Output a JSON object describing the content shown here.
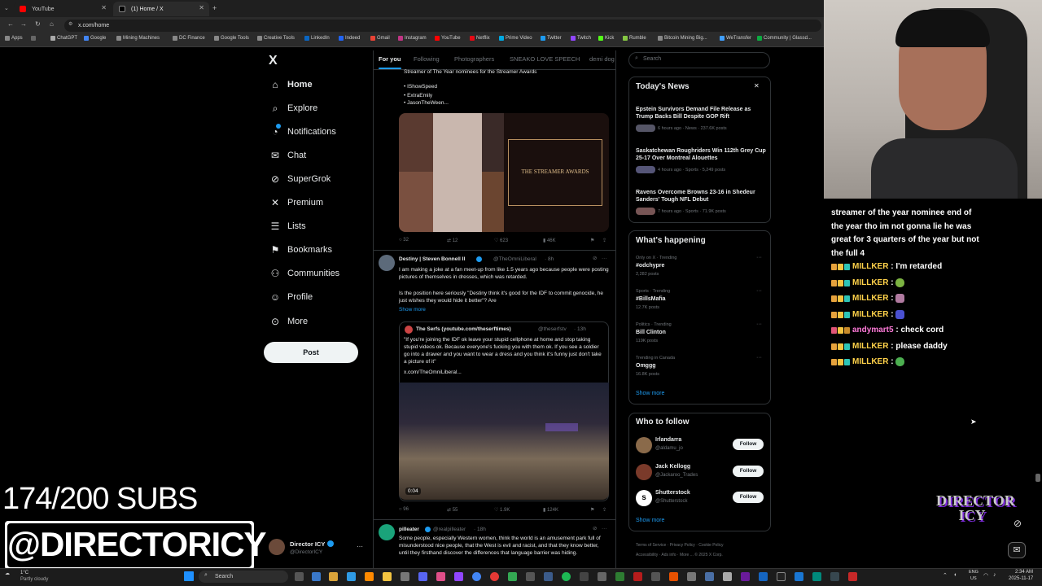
{
  "browser": {
    "tabs": [
      {
        "title": "YouTube"
      },
      {
        "title": "(1) Home / X"
      }
    ],
    "url": "x.com/home",
    "bookmarks": [
      "Apps",
      "ChatGPT",
      "Google",
      "Mining Machines",
      "DC Finance",
      "Google Tools",
      "Creative Tools",
      "LinkedIn",
      "Indeed",
      "Gmail",
      "Instagram",
      "YouTube",
      "Netflix",
      "Prime Video",
      "Twitter",
      "Twitch",
      "Kick",
      "Rumble",
      "Bitcoin Mining Big...",
      "WeTransfer",
      "Community | Glassd..."
    ]
  },
  "x": {
    "logo": "X",
    "nav": [
      {
        "label": "Home",
        "icon": "home-icon"
      },
      {
        "label": "Explore",
        "icon": "search-icon"
      },
      {
        "label": "Notifications",
        "icon": "bell-icon"
      },
      {
        "label": "Chat",
        "icon": "mail-icon"
      },
      {
        "label": "SuperGrok",
        "icon": "grok-icon"
      },
      {
        "label": "Premium",
        "icon": "x-icon"
      },
      {
        "label": "Lists",
        "icon": "list-icon"
      },
      {
        "label": "Bookmarks",
        "icon": "bookmark-icon"
      },
      {
        "label": "Communities",
        "icon": "people-icon"
      },
      {
        "label": "Profile",
        "icon": "person-icon"
      },
      {
        "label": "More",
        "icon": "more-circle-icon"
      }
    ],
    "post_label": "Post",
    "account": {
      "name": "Director ICY",
      "handle": "@DirectorICY"
    },
    "feed_tabs": [
      "For you",
      "Following",
      "Photographers",
      "SNEAKO LOVE SPEECH",
      "demi dog"
    ],
    "search_placeholder": "Search",
    "tweet1": {
      "top_line": "Streamer of The Year nominees for the Streamer Awards",
      "bullets": [
        "• IShowSpeed",
        "• ExtraEmily",
        "• JasonTheWeen..."
      ],
      "image_text": "THE STREAMER AWARDS",
      "stats": {
        "replies": "32",
        "reposts": "12",
        "likes": "623",
        "views": "46K"
      }
    },
    "tweet2": {
      "name": "Destiny | Steven Bonnell II",
      "handle": "@TheOmniLiberal",
      "time": "· 8h",
      "text1": "I am making a joke at a fan meet-up from like 1.5 years ago because people were posting pictures of themselves in dresses, which was retarded.",
      "text2": "Is the position here seriously \"Destiny think it's good for the IDF to commit genocide, he just wishes they would hide it better\"? Are",
      "show_more": "Show more",
      "quote": {
        "name": "The Serfs (youtube.com/theserftimes)",
        "handle": "@theserfstv",
        "time": "· 13h",
        "text": "\"If you're joining the IDF ok leave your stupid cellphone at home and stop taking stupid videos ok. Because everyone's fucking you with them ok. If you see a soldier go into a drawer and you want to wear a dress and you think it's funny just don't take a picture of it\"",
        "link": "x.com/TheOmniLiberal...",
        "video_time": "0:04"
      },
      "stats": {
        "replies": "96",
        "reposts": "55",
        "likes": "1.9K",
        "views": "124K"
      }
    },
    "tweet3": {
      "name": "pilleater",
      "handle": "@realpilleater",
      "time": "· 18h",
      "text": "Some people, especially Western women, think the world is an amusement park full of misunderstood nice people, that the West is evil and racist, and that they know better, until they firsthand discover the differences that language barrier was hiding."
    },
    "news": {
      "title": "Today's News",
      "items": [
        {
          "headline": "Epstein Survivors Demand File Release as Trump Backs Bill Despite GOP Rift",
          "meta": "6 hours ago · News · 237.6K posts"
        },
        {
          "headline": "Saskatchewan Roughriders Win 112th Grey Cup 25-17 Over Montreal Alouettes",
          "meta": "4 hours ago · Sports · 5,249 posts"
        },
        {
          "headline": "Ravens Overcome Browns 23-16 in Shedeur Sanders' Tough NFL Debut",
          "meta": "7 hours ago · Sports · 71.9K posts"
        }
      ]
    },
    "happening": {
      "title": "What's happening",
      "items": [
        {
          "context": "Only on X · Trending",
          "name": "#odchypre",
          "posts": "2,282 posts"
        },
        {
          "context": "Sports · Trending",
          "name": "#BillsMafia",
          "posts": "12.7K posts"
        },
        {
          "context": "Politics · Trending",
          "name": "Bill Clinton",
          "posts": "119K posts"
        },
        {
          "context": "Trending in Canada",
          "name": "Omggg",
          "posts": "16.8K posts"
        }
      ],
      "show_more": "Show more"
    },
    "who_to_follow": {
      "title": "Who to follow",
      "items": [
        {
          "name": "Irlandarra",
          "handle": "@aldamu_jo"
        },
        {
          "name": "Jack Kellogg",
          "handle": "@Jackaroo_Trades"
        },
        {
          "name": "Shutterstock",
          "handle": "@Shutterstock"
        }
      ],
      "follow_label": "Follow",
      "show_more": "Show more"
    },
    "footer": [
      "Terms of Service",
      "Privacy Policy",
      "Cookie Policy",
      "Accessibility",
      "Ads info",
      "More ...",
      "© 2025 X Corp."
    ]
  },
  "chat": {
    "first": "streamer of the year nominee end of the year tho im not gonna lie he was great for 3 quarters of the year but not the full 4",
    "lines": [
      {
        "user": "MILLKER",
        "msg": ": I'm retarded"
      },
      {
        "user": "MILLKER",
        "msg": ":"
      },
      {
        "user": "MILLKER",
        "msg": ":"
      },
      {
        "user": "MILLKER",
        "msg": ":"
      },
      {
        "user": "andymart5",
        "msg": ": check cord"
      },
      {
        "user": "MILLKER",
        "msg": ": please daddy"
      },
      {
        "user": "MILLKER",
        "msg": ":"
      }
    ]
  },
  "overlay": {
    "subs": "174/200 SUBS",
    "handle": "@DIRECTORICY",
    "logo": "DIRECTOR ICY"
  },
  "taskbar": {
    "weather_temp": "1°C",
    "weather_desc": "Partly cloudy",
    "search": "Search",
    "lang": "ENG",
    "region": "US",
    "time": "2:34 AM",
    "date": "2025-11-17"
  }
}
